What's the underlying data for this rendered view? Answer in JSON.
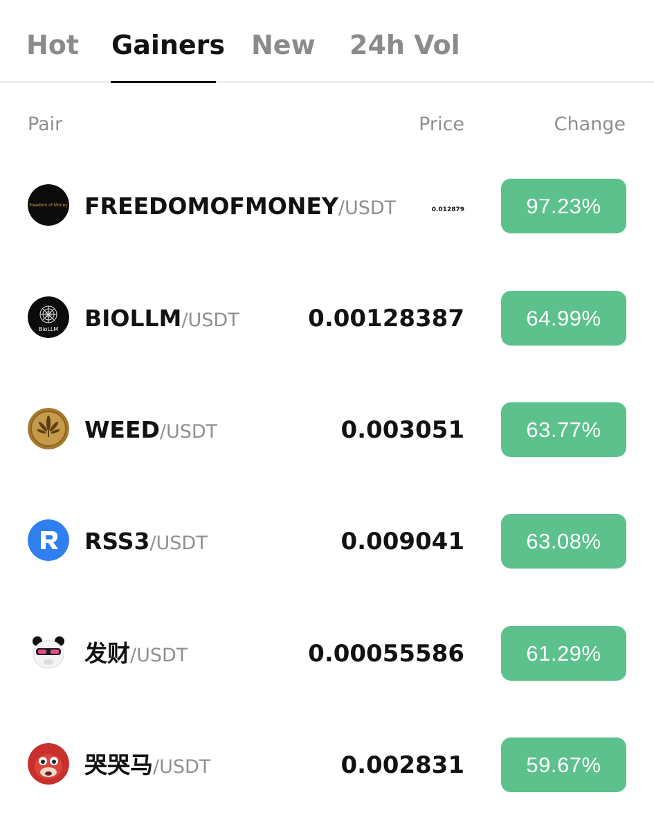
{
  "tabs": [
    {
      "label": "Hot",
      "active": false
    },
    {
      "label": "Gainers",
      "active": true
    },
    {
      "label": "New",
      "active": false
    },
    {
      "label": "24h Vol",
      "active": false
    }
  ],
  "columns": {
    "pair": "Pair",
    "price": "Price",
    "change": "Change"
  },
  "colors": {
    "gain_badge": "#5cc18d",
    "active_tab": "#121212",
    "inactive_tab": "#8b8b8b"
  },
  "rows": [
    {
      "base": "FREEDOMOFMONEY",
      "quote": "/USDT",
      "price": "0.012879",
      "change": "97.23%",
      "logo_text": "Freedom of Money",
      "icon": "freedom-of-money-logo-icon"
    },
    {
      "base": "BIOLLM",
      "quote": "/USDT",
      "price": "0.00128387",
      "change": "64.99%",
      "logo_text": "BioLLM",
      "icon": "biollm-logo-icon"
    },
    {
      "base": "WEED",
      "quote": "/USDT",
      "price": "0.003051",
      "change": "63.77%",
      "icon": "weed-leaf-coin-icon"
    },
    {
      "base": "RSS3",
      "quote": "/USDT",
      "price": "0.009041",
      "change": "63.08%",
      "icon": "rss3-logo-icon"
    },
    {
      "base": "发财",
      "quote": "/USDT",
      "price": "0.00055586",
      "change": "61.29%",
      "icon": "panda-avatar-icon"
    },
    {
      "base": "哭哭马",
      "quote": "/USDT",
      "price": "0.002831",
      "change": "59.67%",
      "icon": "red-horse-avatar-icon"
    }
  ]
}
